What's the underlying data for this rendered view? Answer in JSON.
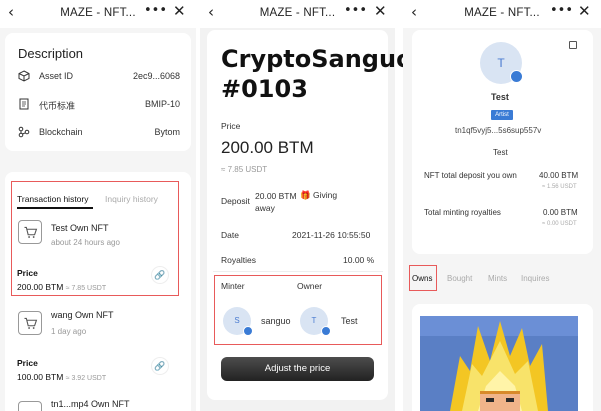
{
  "app": {
    "title": "MAZE - NFT..."
  },
  "panel1": {
    "description_title": "Description",
    "rows": [
      {
        "label": "Asset ID",
        "value": "2ec9...6068"
      },
      {
        "label": "代币标准",
        "value": "BMIP-10"
      },
      {
        "label": "Blockchain",
        "value": "Bytom"
      }
    ],
    "tabs": [
      "Transaction history",
      "Inquiry history"
    ],
    "transactions": [
      {
        "title": "Test Own NFT",
        "time": "about 24 hours ago",
        "price_label": "Price",
        "price": "200.00 BTM",
        "usdt": "≈ 7.85 USDT"
      },
      {
        "title": "wang Own NFT",
        "time": "1 day ago",
        "price_label": "Price",
        "price": "100.00 BTM",
        "usdt": "≈ 3.92 USDT"
      },
      {
        "title": "tn1...mp4 Own NFT"
      }
    ]
  },
  "panel2": {
    "nft_title_line1": "CryptoSanguo",
    "nft_title_line2": "#0103",
    "price_label": "Price",
    "price": "200.00 BTM",
    "usdt": "≈ 7.85 USDT",
    "deposit_label": "Deposit",
    "deposit_value_line1": "20.00 BTM",
    "deposit_value_line2": "away",
    "giving_label": "Giving",
    "date_label": "Date",
    "date_value": "2021-11-26 10:55:50",
    "royalties_label": "Royalties",
    "royalties_value": "10.00 %",
    "minter_label": "Minter",
    "owner_label": "Owner",
    "minter_avatar_letter": "S",
    "minter_name": "sanguo",
    "owner_avatar_letter": "T",
    "owner_name": "Test",
    "adjust_button": "Adjust the price"
  },
  "panel3": {
    "avatar_letter": "T",
    "name": "Test",
    "badge": "Artist",
    "address": "tn1qf5vyj5...5s6sup557v",
    "sub_name": "Test",
    "stats": [
      {
        "label": "NFT total deposit you own",
        "value": "40.00 BTM",
        "usdt": "≈ 1.56 USDT"
      },
      {
        "label": "Total minting royalties",
        "value": "0.00 BTM",
        "usdt": "≈ 0.00 USDT"
      }
    ],
    "tabs": [
      "Owns",
      "Bought",
      "Mints",
      "Inquires"
    ]
  },
  "colors": {
    "highlight": "#e85a5a",
    "accent": "#3a7bd5"
  }
}
